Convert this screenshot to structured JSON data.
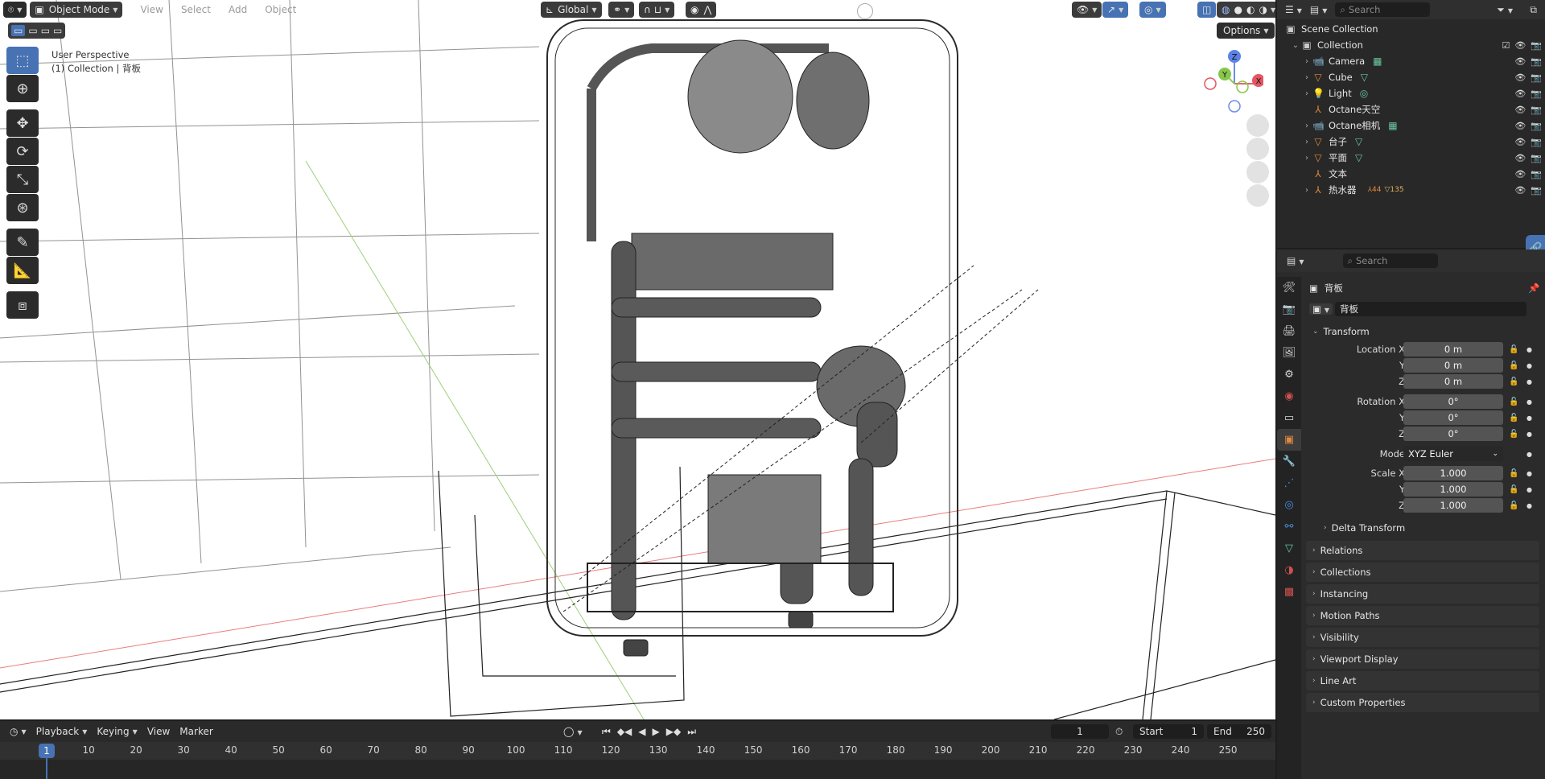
{
  "viewport": {
    "mode": "Object Mode",
    "menus": [
      "View",
      "Select",
      "Add",
      "Object"
    ],
    "transform_orientation": "Global",
    "info_line1": "User Perspective",
    "info_line2": "(1) Collection | 背板",
    "options": "Options",
    "gizmo_axes": {
      "z": "Z",
      "y": "Y",
      "x": "X"
    }
  },
  "tools": [
    {
      "name": "select-box-icon",
      "active": true
    },
    {
      "name": "cursor-icon",
      "active": false
    },
    {
      "name": "move-icon",
      "active": false
    },
    {
      "name": "rotate-icon",
      "active": false
    },
    {
      "name": "scale-icon",
      "active": false
    },
    {
      "name": "transform-icon",
      "active": false
    },
    {
      "name": "annotate-icon",
      "active": false
    },
    {
      "name": "measure-icon",
      "active": false
    },
    {
      "name": "add-cube-icon",
      "active": false
    }
  ],
  "outliner": {
    "search_placeholder": "Search",
    "scene_collection": "Scene Collection",
    "collection": "Collection",
    "items": [
      {
        "label": "Camera"
      },
      {
        "label": "Cube"
      },
      {
        "label": "Light"
      },
      {
        "label": "Octane天空"
      },
      {
        "label": "Octane相机"
      },
      {
        "label": "台子"
      },
      {
        "label": "平面"
      },
      {
        "label": "文本"
      },
      {
        "label": "热水器",
        "badge": "44",
        "badge2": "135"
      }
    ]
  },
  "properties": {
    "search_placeholder": "Search",
    "object_title": "背板",
    "object_name": "背板",
    "transform": "Transform",
    "location_x_label": "Location X",
    "location_x": "0 m",
    "location_y_label": "Y",
    "location_y": "0 m",
    "location_z_label": "Z",
    "location_z": "0 m",
    "rotation_x_label": "Rotation X",
    "rotation_x": "0°",
    "rotation_y_label": "Y",
    "rotation_y": "0°",
    "rotation_z_label": "Z",
    "rotation_z": "0°",
    "mode_label": "Mode",
    "mode_value": "XYZ Euler",
    "scale_x_label": "Scale X",
    "scale_x": "1.000",
    "scale_y_label": "Y",
    "scale_y": "1.000",
    "scale_z_label": "Z",
    "scale_z": "1.000",
    "delta_transform": "Delta Transform",
    "panels": [
      "Relations",
      "Collections",
      "Instancing",
      "Motion Paths",
      "Visibility",
      "Viewport Display",
      "Line Art",
      "Custom Properties"
    ]
  },
  "timeline": {
    "playback": "Playback",
    "keying": "Keying",
    "view": "View",
    "marker": "Marker",
    "current_frame": "1",
    "start_label": "Start",
    "start": "1",
    "end_label": "End",
    "end": "250",
    "ticks": [
      "10",
      "20",
      "30",
      "40",
      "50",
      "60",
      "70",
      "80",
      "90",
      "100",
      "110",
      "120",
      "130",
      "140",
      "150",
      "160",
      "170",
      "180",
      "190",
      "200",
      "210",
      "220",
      "230",
      "240",
      "250"
    ],
    "ruler_current": "1"
  }
}
